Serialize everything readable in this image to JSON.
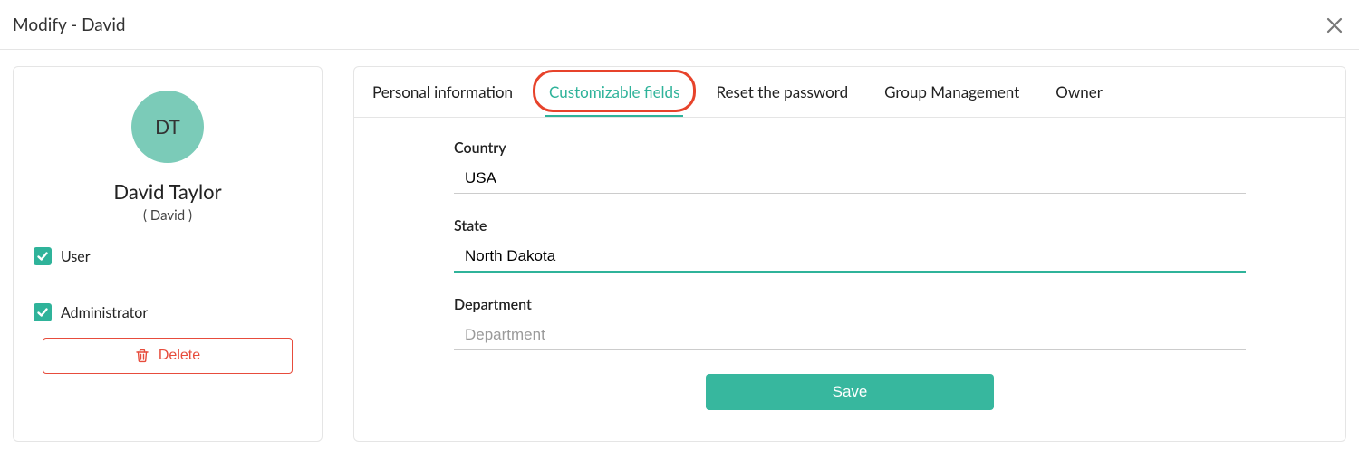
{
  "header": {
    "title": "Modify - David"
  },
  "profile": {
    "initials": "DT",
    "full_name": "David Taylor",
    "handle": "( David )"
  },
  "roles": {
    "user_label": "User",
    "admin_label": "Administrator"
  },
  "actions": {
    "delete_label": "Delete"
  },
  "tabs": {
    "personal": "Personal information",
    "custom": "Customizable fields",
    "reset": "Reset the password",
    "group": "Group Management",
    "owner": "Owner"
  },
  "fields": {
    "country": {
      "label": "Country",
      "value": "USA"
    },
    "state": {
      "label": "State",
      "value": "North Dakota"
    },
    "department": {
      "label": "Department",
      "value": "",
      "placeholder": "Department"
    }
  },
  "buttons": {
    "save_label": "Save"
  }
}
